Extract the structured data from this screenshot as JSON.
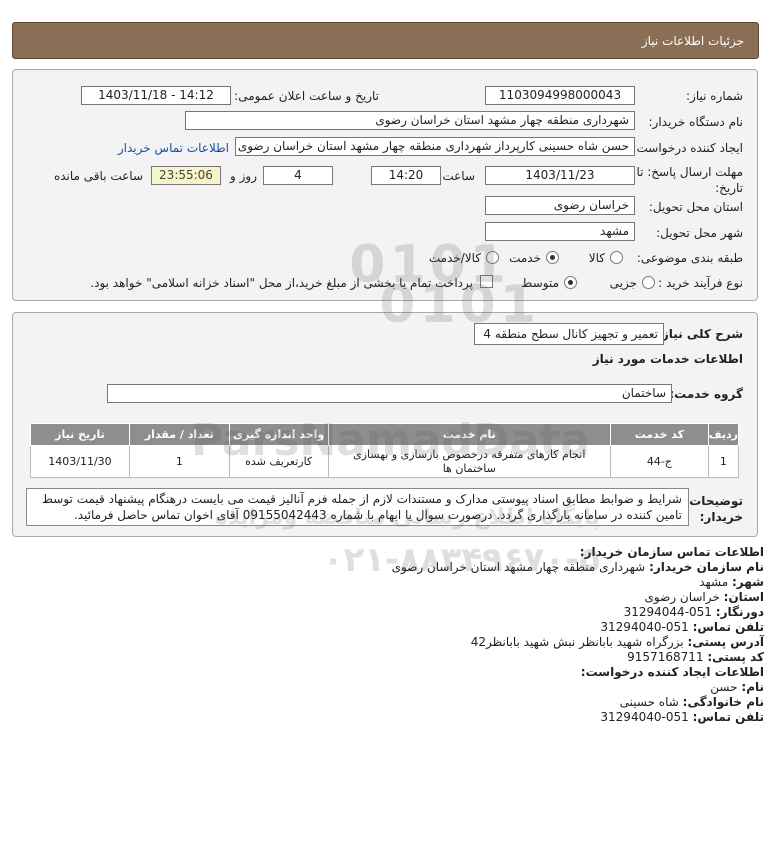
{
  "page_title": "جزئیات اطلاعات نیاز",
  "need_number_label": "شماره نیاز:",
  "need_number": "1103094998000043",
  "announce_label": "تاریخ و ساعت اعلان عمومی:",
  "announce_value": "1403/11/18 - 14:12",
  "buyer_label": "نام دستگاه خریدار:",
  "buyer_value": "شهرداری منطقه چهار مشهد استان خراسان رضوی",
  "creator_label": "ایجاد کننده درخواست:",
  "creator_value": "حسن شاه حسینی کارپرداز شهرداری منطقه چهار مشهد استان خراسان رضوی",
  "contact_link": "اطلاعات تماس خریدار",
  "deadline_label": "مهلت ارسال پاسخ: تا تاریخ:",
  "deadline_date": "1403/11/23",
  "time_label": "ساعت",
  "deadline_time": "14:20",
  "days_value": "4",
  "days_label": "روز و",
  "remaining_time": "23:55:06",
  "remaining_label": "ساعت باقی مانده",
  "province_label": "استان محل تحویل:",
  "province_value": "خراسان رضوی",
  "city_label": "شهر محل تحویل:",
  "city_value": "مشهد",
  "category_label": "طبقه بندی موضوعی:",
  "category_options": [
    "کالا",
    "خدمت",
    "کالا/خدمت"
  ],
  "process_label": "نوع فرآیند خرید :",
  "process_options": [
    "جزیی",
    "متوسط"
  ],
  "payment_note": "پرداخت تمام یا بخشی از مبلغ خرید،از محل \"اسناد خزانه اسلامی\" خواهد بود.",
  "summary_label": "شرح کلی نیاز:",
  "summary_value": "تعمیر و تجهیز کانال سطح منطقه 4",
  "services_title": "اطلاعات خدمات مورد نیاز",
  "service_group_label": "گروه خدمت:",
  "service_group_value": "ساختمان",
  "table_headers": [
    "ردیف",
    "کد خدمت",
    "نام خدمت",
    "واحد اندازه گیری",
    "تعداد / مقدار",
    "تاریخ نیاز"
  ],
  "table_rows": [
    [
      "1",
      "ج-44",
      "انجام کارهای متفرقه درخصوص بازسازی و بهسازی ساختمان ها",
      "کارتعریف شده",
      "1",
      "1403/11/30"
    ]
  ],
  "notes_label": "توضیحات خریدار:",
  "notes_value": "شرایط و ضوابط مطابق اسناد پیوستی مدارک و مستندات لازم از جمله فرم آنالیز قیمت می بایست درهنگام پیشنهاد قیمت توسط تامین کننده در سامانه بارگذاری گردد. درصورت سوال یا ابهام با شماره 09155042443 آقای اخوان تماس حاصل فرمائید.",
  "buyer_contact": {
    "title": "اطلاعات تماس سازمان خریدار:",
    "org_label": "نام سازمان خریدار:",
    "org_value": "شهرداری منطقه چهار مشهد استان خراسان رضوی",
    "city_label": "شهر:",
    "city_value": "مشهد",
    "province_label": "استان:",
    "province_value": "خراسان رضوی",
    "fax_label": "دورنگار:",
    "fax_value": "051-31294044",
    "phone_label": "تلفن تماس:",
    "phone_value": "051-31294040",
    "address_label": "آدرس پستی:",
    "address_value": "بزرگراه شهید بابانظر نبش شهید بابانظر42",
    "postal_label": "کد پستی:",
    "postal_value": "9157168711"
  },
  "creator_contact": {
    "title": "اطلاعات ایجاد کننده درخواست:",
    "name_label": "نام:",
    "name_value": "حسن",
    "family_label": "نام خانوادگی:",
    "family_value": "شاه حسینی",
    "phone_label": "تلفن تماس:",
    "phone_value": "051-31294040"
  },
  "watermark": {
    "brand": "ParsNamadData",
    "line1": "پایگاه اطلاع رسانی مناقصه ومزایده",
    "phone": "۰۲۱-۸۸۳۴۹۶۷۰-۵",
    "digits": "0101"
  },
  "colors": {
    "title_bar": "#8a6e55",
    "panel_bg": "#f3f3f3",
    "table_header": "#8e8e8e",
    "link": "#1a4fa3",
    "time_box": "#f5f5c8"
  },
  "icons": [
    "radio-icon",
    "checkbox-icon"
  ]
}
